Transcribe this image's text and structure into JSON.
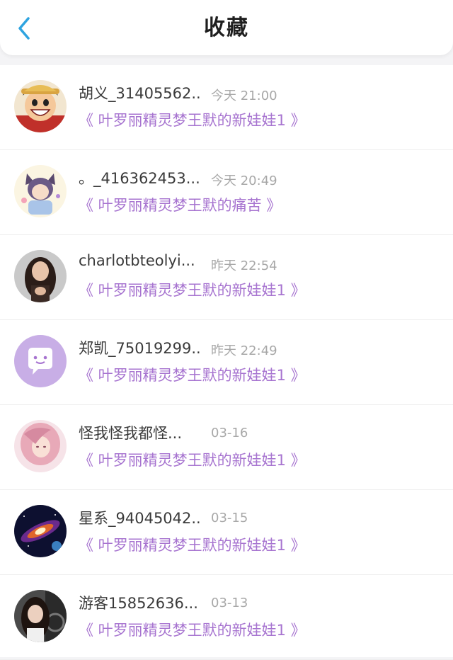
{
  "header": {
    "title": "收藏",
    "back_icon": "chevron-left-icon",
    "back_color": "#2fa4e0"
  },
  "accent": "#a774d0",
  "items": [
    {
      "name": "胡义_31405562...",
      "time": "今天 21:00",
      "work": "《 叶罗丽精灵梦王默的新娃娃1 》",
      "avatar": "anime-pirate-avatar"
    },
    {
      "name": "。_416362453...",
      "time": "今天 20:49",
      "work": "《 叶罗丽精灵梦王默的痛苦 》",
      "avatar": "anime-cat-girl-avatar"
    },
    {
      "name": "charlotbteolyi...",
      "time": "昨天 22:54",
      "work": "《 叶罗丽精灵梦王默的新娃娃1 》",
      "avatar": "photo-woman-avatar"
    },
    {
      "name": "郑凯_75019299...",
      "time": "昨天 22:49",
      "work": "《 叶罗丽精灵梦王默的新娃娃1 》",
      "avatar": "default-chat-bubble-avatar"
    },
    {
      "name": "怪我怪我都怪...",
      "time": "03-16",
      "work": "《 叶罗丽精灵梦王默的新娃娃1 》",
      "avatar": "pink-hair-girl-avatar"
    },
    {
      "name": "星系_94045042...",
      "time": "03-15",
      "work": "《 叶罗丽精灵梦王默的新娃娃1 》",
      "avatar": "galaxy-avatar"
    },
    {
      "name": "游客15852636...",
      "time": "03-13",
      "work": "《 叶罗丽精灵梦王默的新娃娃1 》",
      "avatar": "photo-girl-car-avatar"
    }
  ]
}
